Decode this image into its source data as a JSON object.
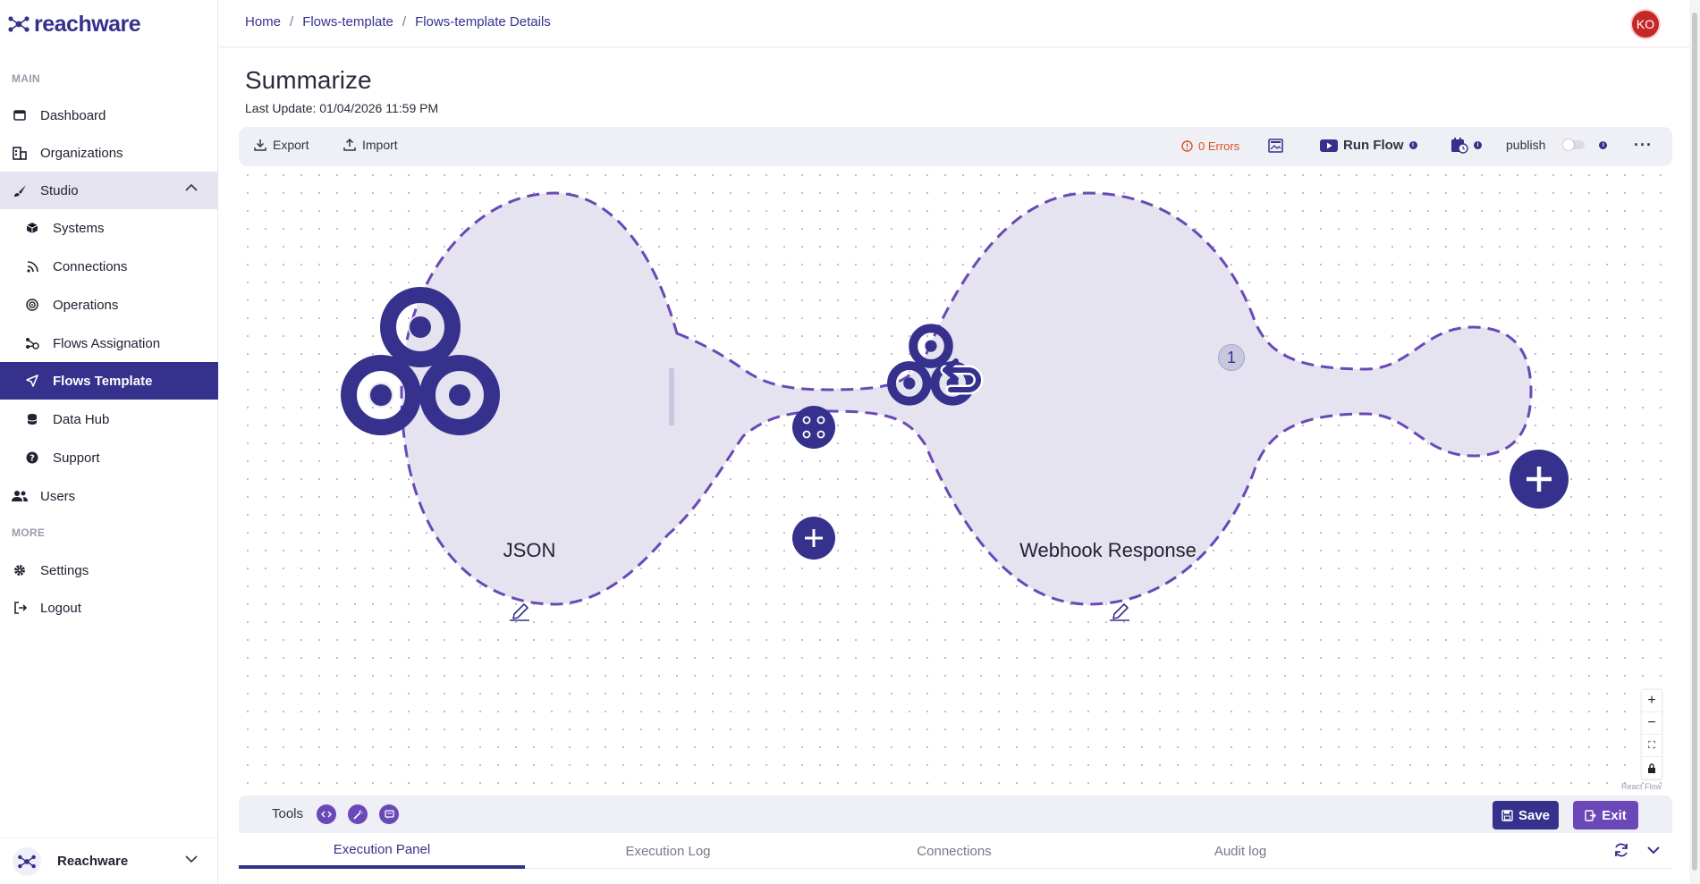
{
  "brand": {
    "name": "reachware",
    "color": "#35318c"
  },
  "sidebar": {
    "section_main": "MAIN",
    "section_more": "MORE",
    "items": [
      {
        "label": "Dashboard",
        "icon": "dashboard-icon"
      },
      {
        "label": "Organizations",
        "icon": "organizations-icon"
      },
      {
        "label": "Studio",
        "icon": "brush-icon",
        "expanded": true
      },
      {
        "label": "Systems",
        "icon": "box-icon"
      },
      {
        "label": "Connections",
        "icon": "rss-icon"
      },
      {
        "label": "Operations",
        "icon": "target-icon"
      },
      {
        "label": "Flows Assignation",
        "icon": "flows-assign-icon"
      },
      {
        "label": "Flows Template",
        "icon": "send-icon",
        "active": true
      },
      {
        "label": "Data Hub",
        "icon": "database-icon"
      },
      {
        "label": "Support",
        "icon": "help-icon"
      },
      {
        "label": "Users",
        "icon": "users-icon"
      },
      {
        "label": "Settings",
        "icon": "gear-icon"
      },
      {
        "label": "Logout",
        "icon": "logout-icon"
      }
    ],
    "footer_org": "Reachware"
  },
  "header": {
    "breadcrumb": [
      "Home",
      "Flows-template",
      "Flows-template Details"
    ],
    "avatar_initials": "KO"
  },
  "page": {
    "title": "Summarize",
    "last_update": "Last Update: 01/04/2026 11:59 PM"
  },
  "toolbar": {
    "export": "Export",
    "import": "Import",
    "errors": "0 Errors",
    "run_flow": "Run Flow",
    "publish": "publish"
  },
  "flow": {
    "nodes": [
      {
        "label": "JSON"
      },
      {
        "label": "Webhook Response",
        "badge": "1"
      }
    ],
    "attribution": "React Flow"
  },
  "tools": {
    "label": "Tools",
    "save": "Save",
    "exit": "Exit"
  },
  "tabs": [
    "Execution Panel",
    "Execution Log",
    "Connections",
    "Audit log"
  ],
  "colors": {
    "primary": "#35318c",
    "accent": "#6a48b8",
    "node_fill": "#e4e3ef",
    "error": "#d9531e",
    "avatar": "#c62828"
  }
}
